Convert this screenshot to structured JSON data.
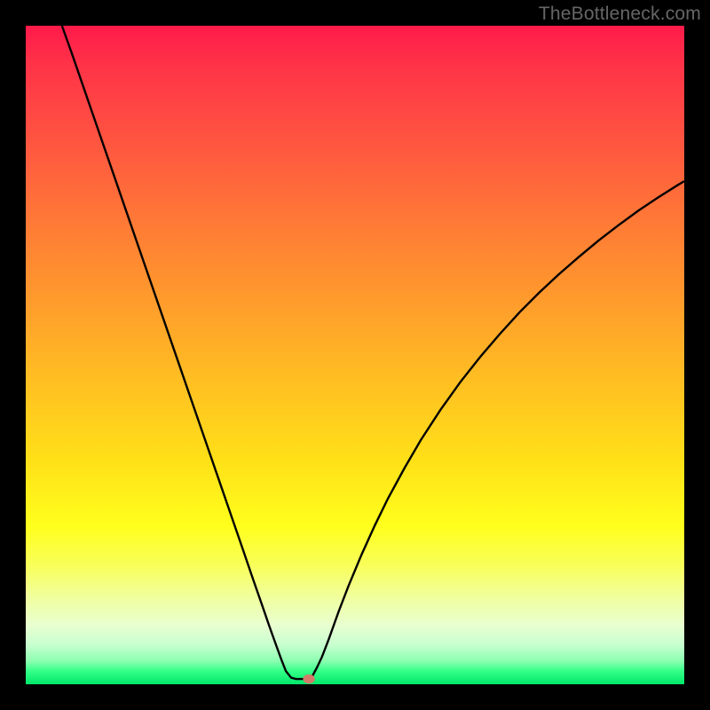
{
  "watermark": "TheBottleneck.com",
  "chart_data": {
    "type": "line",
    "title": "",
    "xlabel": "",
    "ylabel": "",
    "xlim": [
      0,
      100
    ],
    "ylim": [
      0,
      100
    ],
    "grid": false,
    "legend": false,
    "curve_points": [
      [
        5.5,
        100.0
      ],
      [
        7.0,
        95.8
      ],
      [
        9.0,
        90.0
      ],
      [
        11.0,
        84.2
      ],
      [
        13.0,
        78.4
      ],
      [
        15.0,
        72.6
      ],
      [
        17.0,
        66.8
      ],
      [
        19.0,
        61.0
      ],
      [
        21.0,
        55.2
      ],
      [
        23.0,
        49.4
      ],
      [
        25.0,
        43.6
      ],
      [
        27.0,
        37.8
      ],
      [
        29.0,
        32.0
      ],
      [
        31.0,
        26.2
      ],
      [
        33.0,
        20.4
      ],
      [
        34.5,
        16.0
      ],
      [
        36.0,
        11.7
      ],
      [
        37.0,
        8.8
      ],
      [
        38.0,
        6.0
      ],
      [
        38.8,
        3.8
      ],
      [
        39.5,
        2.0
      ],
      [
        40.3,
        1.0
      ],
      [
        41.0,
        0.8
      ],
      [
        42.0,
        0.8
      ],
      [
        42.8,
        0.8
      ],
      [
        43.5,
        1.2
      ],
      [
        44.2,
        2.5
      ],
      [
        45.0,
        4.2
      ],
      [
        46.0,
        6.8
      ],
      [
        47.5,
        11.0
      ],
      [
        49.0,
        14.9
      ],
      [
        51.0,
        19.7
      ],
      [
        53.0,
        24.1
      ],
      [
        55.0,
        28.2
      ],
      [
        57.5,
        32.8
      ],
      [
        60.0,
        37.1
      ],
      [
        63.0,
        41.7
      ],
      [
        66.0,
        45.9
      ],
      [
        69.0,
        49.7
      ],
      [
        72.0,
        53.2
      ],
      [
        75.0,
        56.5
      ],
      [
        78.0,
        59.5
      ],
      [
        81.0,
        62.3
      ],
      [
        84.0,
        64.9
      ],
      [
        87.0,
        67.4
      ],
      [
        90.0,
        69.7
      ],
      [
        93.0,
        71.9
      ],
      [
        96.0,
        73.9
      ],
      [
        99.0,
        75.8
      ],
      [
        100.0,
        76.4
      ]
    ],
    "marker": {
      "x": 43.0,
      "y": 0.8
    },
    "colors": {
      "curve": "#000000",
      "marker_fill": "#d47a6a",
      "gradient_top": "#ff1a4a",
      "gradient_bottom": "#00e86a"
    }
  }
}
